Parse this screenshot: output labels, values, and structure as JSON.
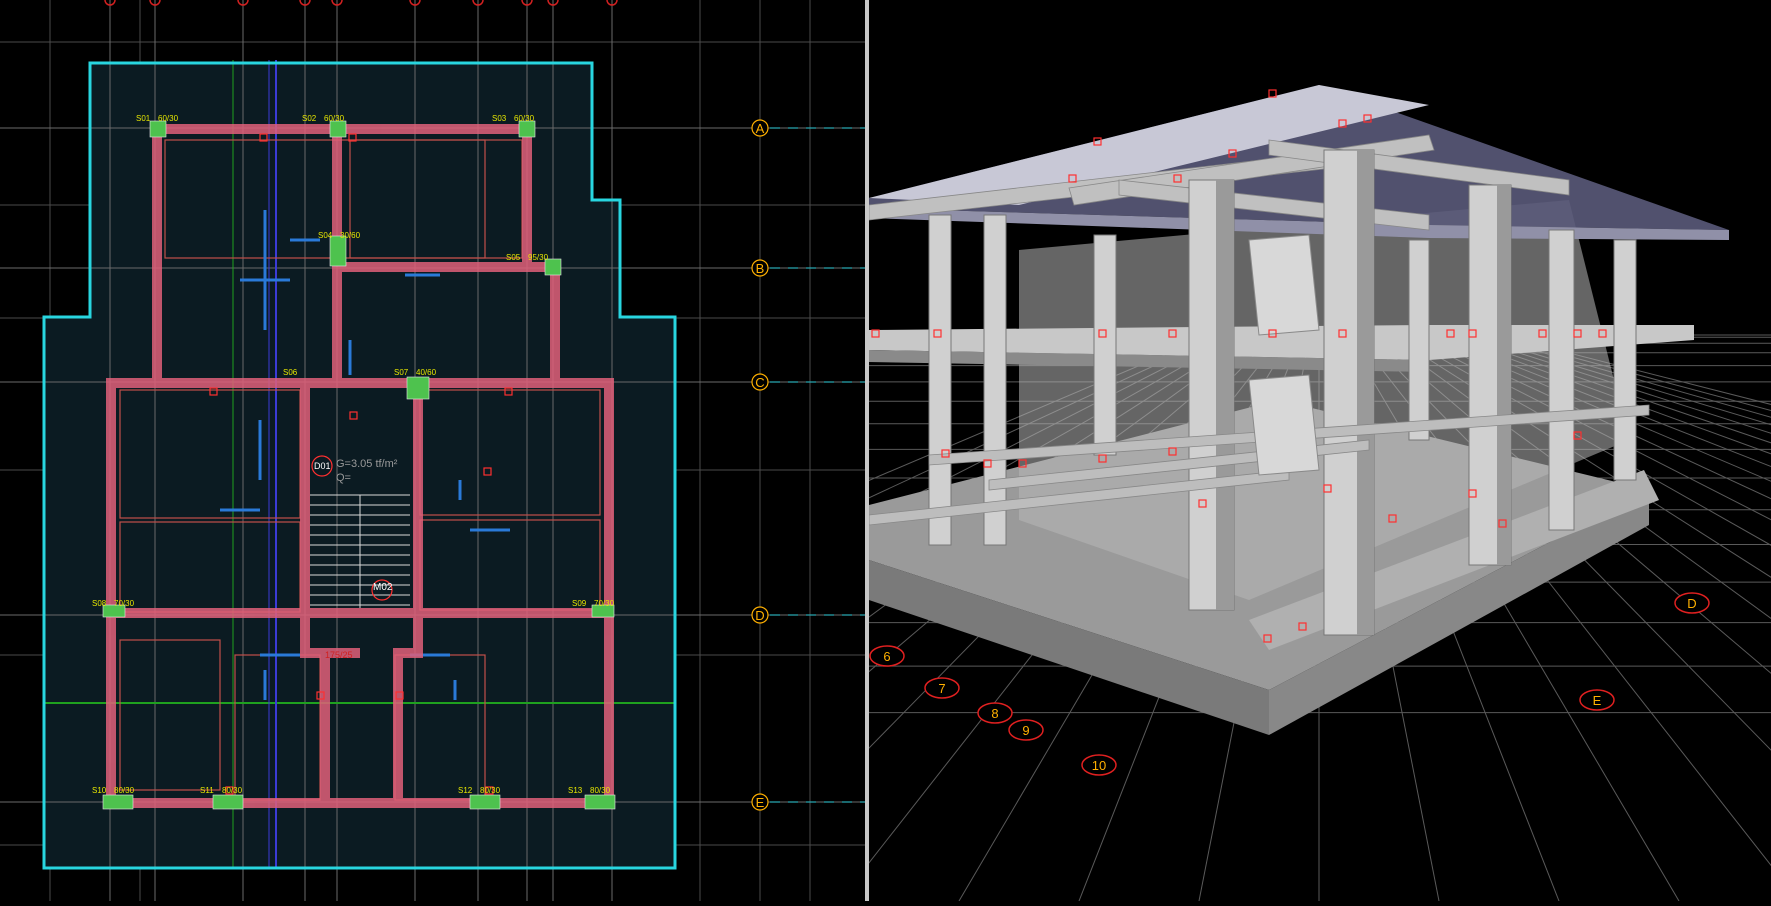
{
  "plan_view": {
    "axis_rows": [
      "A",
      "B",
      "C",
      "D",
      "E"
    ],
    "column_labels": [
      {
        "name": "S01",
        "size": "60/30"
      },
      {
        "name": "S02",
        "size": "60/30"
      },
      {
        "name": "S03",
        "size": "60/30"
      },
      {
        "name": "S04",
        "size": "30/60"
      },
      {
        "name": "S05",
        "size": "95/30"
      },
      {
        "name": "S06",
        "size": ""
      },
      {
        "name": "S07",
        "size": "40/60"
      },
      {
        "name": "S08",
        "size": "70/30"
      },
      {
        "name": "S09",
        "size": "70/30"
      },
      {
        "name": "S10",
        "size": "80/30"
      },
      {
        "name": "S11",
        "size": "80/30"
      },
      {
        "name": "S12",
        "size": "80/30"
      },
      {
        "name": "S13",
        "size": "80/30"
      }
    ],
    "slab_label": "D01",
    "load_g": "G=3.05 tf/m²",
    "load_q": "Q=",
    "stair_label": "M02",
    "beam_label": "175/25"
  },
  "model_view": {
    "axis_bubbles": [
      "6",
      "7",
      "8",
      "9",
      "10",
      "E",
      "D"
    ]
  },
  "colors": {
    "outline": "#28d6e0",
    "wall": "#e0607a",
    "axis_label": "#ffb000",
    "grid": "#5a5a5a",
    "plan_bg": "#0b1b22"
  }
}
